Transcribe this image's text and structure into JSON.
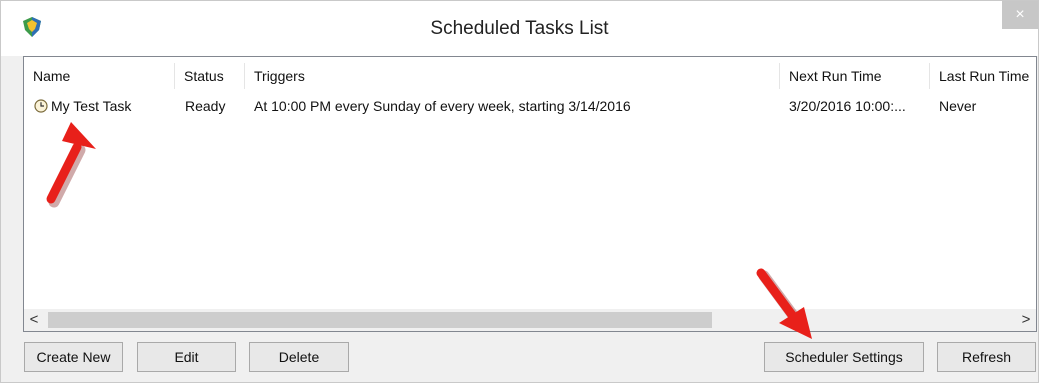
{
  "window": {
    "title": "Scheduled Tasks List",
    "close_label": "×"
  },
  "columns": [
    "Name",
    "Status",
    "Triggers",
    "Next Run Time",
    "Last Run Time"
  ],
  "tasks": [
    {
      "name": "My Test Task",
      "status": "Ready",
      "triggers": "At 10:00 PM every Sunday of every week, starting 3/14/2016",
      "next_run": "3/20/2016 10:00:...",
      "last_run": "Never",
      "icon": "clock-icon"
    }
  ],
  "scrollbar": {
    "left_arrow": "<",
    "right_arrow": ">"
  },
  "buttons": {
    "create_new": "Create New",
    "edit": "Edit",
    "delete": "Delete",
    "scheduler_settings": "Scheduler Settings",
    "refresh": "Refresh"
  },
  "annotations": {
    "arrow_color": "#e8201a"
  }
}
